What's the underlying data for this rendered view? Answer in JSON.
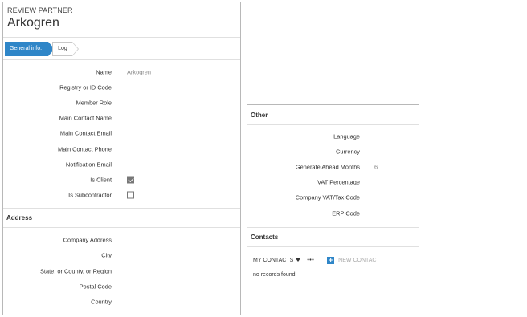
{
  "partner": {
    "subtitle": "REVIEW PARTNER",
    "name": "Arkogren"
  },
  "tabs": [
    {
      "label": "General info."
    },
    {
      "label": "Log"
    }
  ],
  "general": {
    "rows": [
      {
        "label": "Name",
        "value": "Arkogren"
      },
      {
        "label": "Registry or ID Code",
        "value": ""
      },
      {
        "label": "Member Role",
        "value": ""
      },
      {
        "label": "Main Contact Name",
        "value": ""
      },
      {
        "label": "Main Contact Email",
        "value": ""
      },
      {
        "label": "Main Contact Phone",
        "value": ""
      },
      {
        "label": "Notification Email",
        "value": ""
      }
    ],
    "is_client": {
      "label": "Is Client",
      "checked": true
    },
    "is_subcontractor": {
      "label": "Is Subcontractor",
      "checked": false
    }
  },
  "address": {
    "title": "Address",
    "rows": [
      {
        "label": "Company Address",
        "value": ""
      },
      {
        "label": "City",
        "value": ""
      },
      {
        "label": "State, or County, or Region",
        "value": ""
      },
      {
        "label": "Postal Code",
        "value": ""
      },
      {
        "label": "Country",
        "value": ""
      }
    ]
  },
  "other": {
    "title": "Other",
    "rows": [
      {
        "label": "Language",
        "value": ""
      },
      {
        "label": "Currency",
        "value": ""
      },
      {
        "label": "Generate Ahead Months",
        "value": "6"
      },
      {
        "label": "VAT Percentage",
        "value": ""
      },
      {
        "label": "Company VAT/Tax Code",
        "value": ""
      },
      {
        "label": "ERP Code",
        "value": ""
      }
    ]
  },
  "contacts": {
    "title": "Contacts",
    "filter_label": "MY CONTACTS",
    "more_label": "•••",
    "new_contact_label": "NEW CONTACT",
    "plus_glyph": "+",
    "empty_text": "no records found."
  }
}
